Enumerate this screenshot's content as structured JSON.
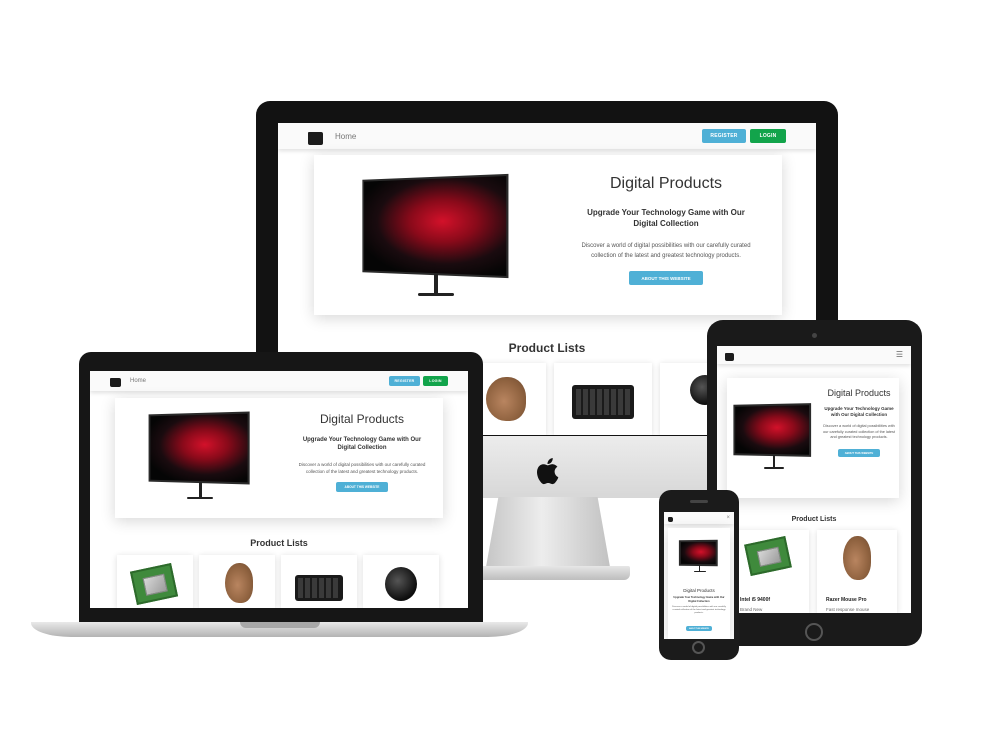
{
  "site": {
    "nav_home": "Home",
    "register_label": "REGISTER",
    "login_label": "LOGIN",
    "hero_title": "Digital Products",
    "hero_subtitle": "Upgrade Your Technology Game with Our Digital Collection",
    "hero_description": "Discover a world of digital possibilities with our carefully curated collection of the latest and greatest technology products.",
    "about_button": "ABOUT THIS WEBSITE",
    "products_heading": "Product Lists",
    "products": [
      {
        "name": "Intel i5 9400f",
        "desc": "Brand New"
      },
      {
        "name": "Razer Mouse Pro",
        "desc": "Fast response mouse"
      }
    ]
  },
  "icons": {
    "logo": "shopping-bag-icon",
    "menu": "hamburger-menu-icon",
    "close": "close-icon",
    "brand": "apple-logo-icon"
  },
  "colors": {
    "register": "#4fb0d6",
    "login": "#12a44b",
    "about": "#4fb0d6"
  }
}
